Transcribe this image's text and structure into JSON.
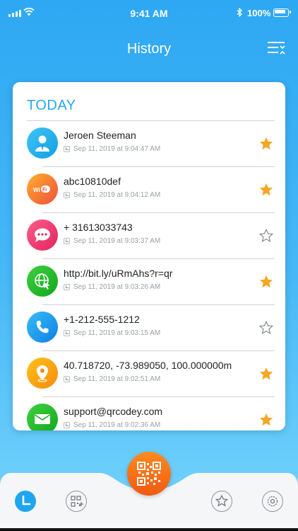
{
  "status_bar": {
    "time": "9:41 AM",
    "battery": "100%"
  },
  "header": {
    "title": "History"
  },
  "section": {
    "title": "TODAY"
  },
  "colors": {
    "accent": "#2aa8ef",
    "star_active": "#f5a623",
    "scan_button": "#f26a17"
  },
  "history": [
    {
      "icon": "contact-icon",
      "title": "Jeroen Steeman",
      "time": "Sep 11, 2019 at 9:04:47 AM",
      "starred": true
    },
    {
      "icon": "wifi-icon",
      "title": "abc10810def",
      "time": "Sep 11, 2019 at 9:04:12 AM",
      "starred": true
    },
    {
      "icon": "sms-icon",
      "title": "+ 31613033743",
      "time": "Sep 11, 2019 at 9:03:37 AM",
      "starred": false
    },
    {
      "icon": "url-icon",
      "title": "http://bit.ly/uRmAhs?r=qr",
      "time": "Sep 11, 2019 at 9:03:26 AM",
      "starred": true
    },
    {
      "icon": "phone-icon",
      "title": "+1-212-555-1212",
      "time": "Sep 11, 2019 at 9:03:15 AM",
      "starred": false
    },
    {
      "icon": "location-icon",
      "title": "40.718720, -73.989050, 100.000000m",
      "time": "Sep 11, 2019 at 9:02:51 AM",
      "starred": true
    },
    {
      "icon": "email-icon",
      "title": "support@qrcodey.com",
      "time": "Sep 11, 2019 at 9:02:36 AM",
      "starred": true
    }
  ],
  "tab_bar": {
    "tabs": [
      {
        "name": "history-tab-icon",
        "active": true
      },
      {
        "name": "create-qr-tab-icon",
        "active": false
      },
      {
        "name": "favorites-tab-icon",
        "active": false
      },
      {
        "name": "settings-tab-icon",
        "active": false
      }
    ]
  }
}
